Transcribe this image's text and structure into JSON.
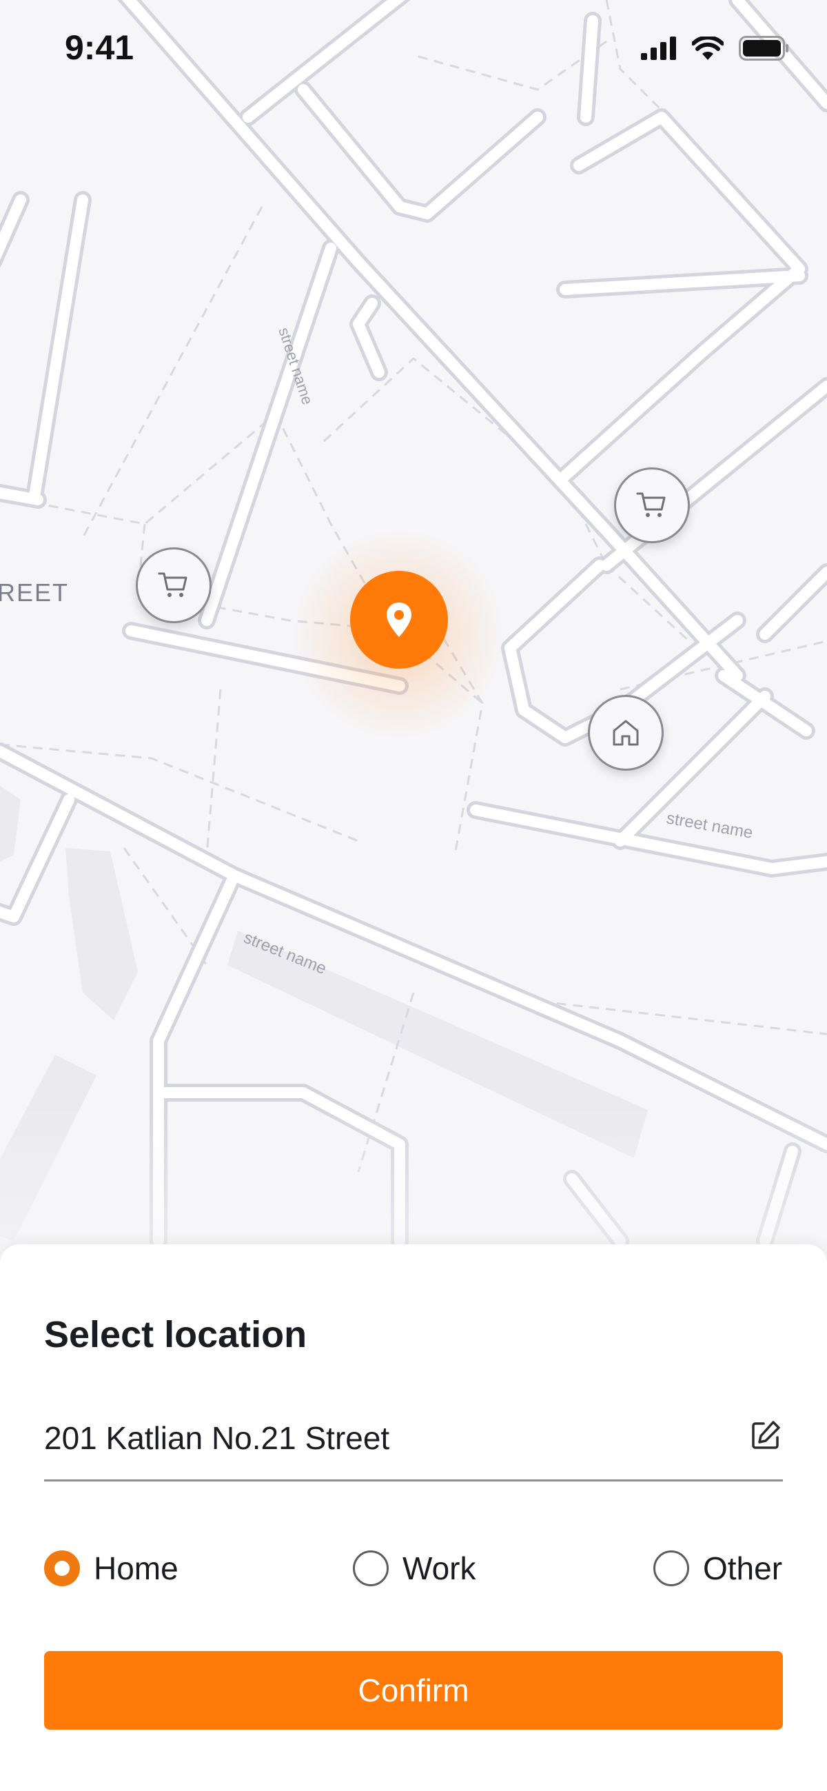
{
  "status_bar": {
    "time": "9:41",
    "icons": [
      "cellular-signal-icon",
      "wifi-icon",
      "battery-icon"
    ]
  },
  "map": {
    "street_labels": [
      "REET",
      "street name",
      "street name",
      "street name"
    ],
    "markers": [
      "shopping-cart-icon",
      "shopping-cart-icon",
      "home-icon",
      "location-pin-icon"
    ]
  },
  "sheet": {
    "title": "Select location",
    "address": "201 Katlian No.21 Street",
    "edit_icon": "edit-icon",
    "options": [
      {
        "label": "Home",
        "selected": true
      },
      {
        "label": "Work",
        "selected": false
      },
      {
        "label": "Other",
        "selected": false
      }
    ],
    "confirm_label": "Confirm"
  },
  "colors": {
    "accent": "#FF7A08",
    "map_background": "#F6F6F8",
    "road": "#FFFFFF",
    "road_outline": "#D9D9E2"
  }
}
